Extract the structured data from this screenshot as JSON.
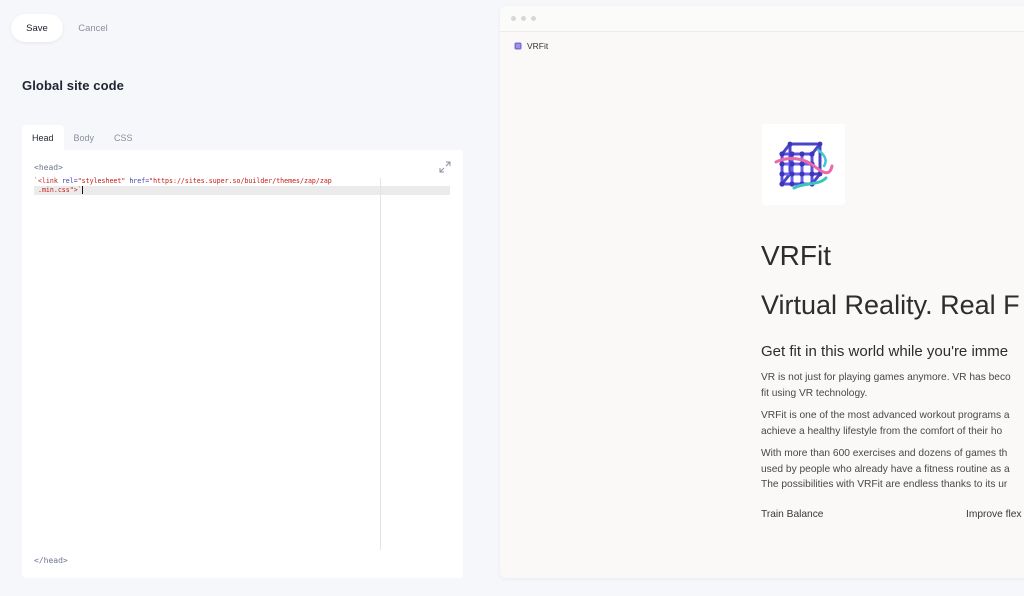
{
  "toolbar": {
    "save_label": "Save",
    "cancel_label": "Cancel"
  },
  "page": {
    "title": "Global site code"
  },
  "tabs": [
    {
      "label": "Head",
      "active": true
    },
    {
      "label": "Body",
      "active": false
    },
    {
      "label": "CSS",
      "active": false
    }
  ],
  "editor": {
    "open_tag": "<head>",
    "close_tag": "</head>",
    "code": {
      "quote_open": "`",
      "tag_open": "<link",
      "attr1": " rel=",
      "val1": "\"stylesheet\"",
      "attr2": " href=",
      "val2": "\"https://sites.super.so/builder/themes/zap/zap",
      "val2_cont": " .min.css\"",
      "tag_close": ">",
      "quote_close": "`"
    }
  },
  "preview": {
    "breadcrumb": "VRFit",
    "site_name": "VRFit",
    "heading1": "Virtual Reality. Real F",
    "heading2": "Get fit in this world while you're imme",
    "paragraphs": [
      {
        "line1": "VR is not just for playing games anymore. VR has beco",
        "line2": "fit using VR technology."
      },
      {
        "line1": "VRFit is one of the most advanced workout programs a",
        "line2": "achieve a healthy lifestyle from the comfort of their ho"
      },
      {
        "line1": "With more than 600 exercises and dozens of games th",
        "line2": "used by people who already have a fitness routine as a",
        "line3": "The possibilities with VRFit are endless thanks to its ur"
      }
    ],
    "columns": [
      "Train Balance",
      "Improve flex"
    ]
  },
  "icons": {
    "expand": "expand-icon",
    "breadcrumb": "page-icon",
    "logo": "vr-cube-logo"
  }
}
